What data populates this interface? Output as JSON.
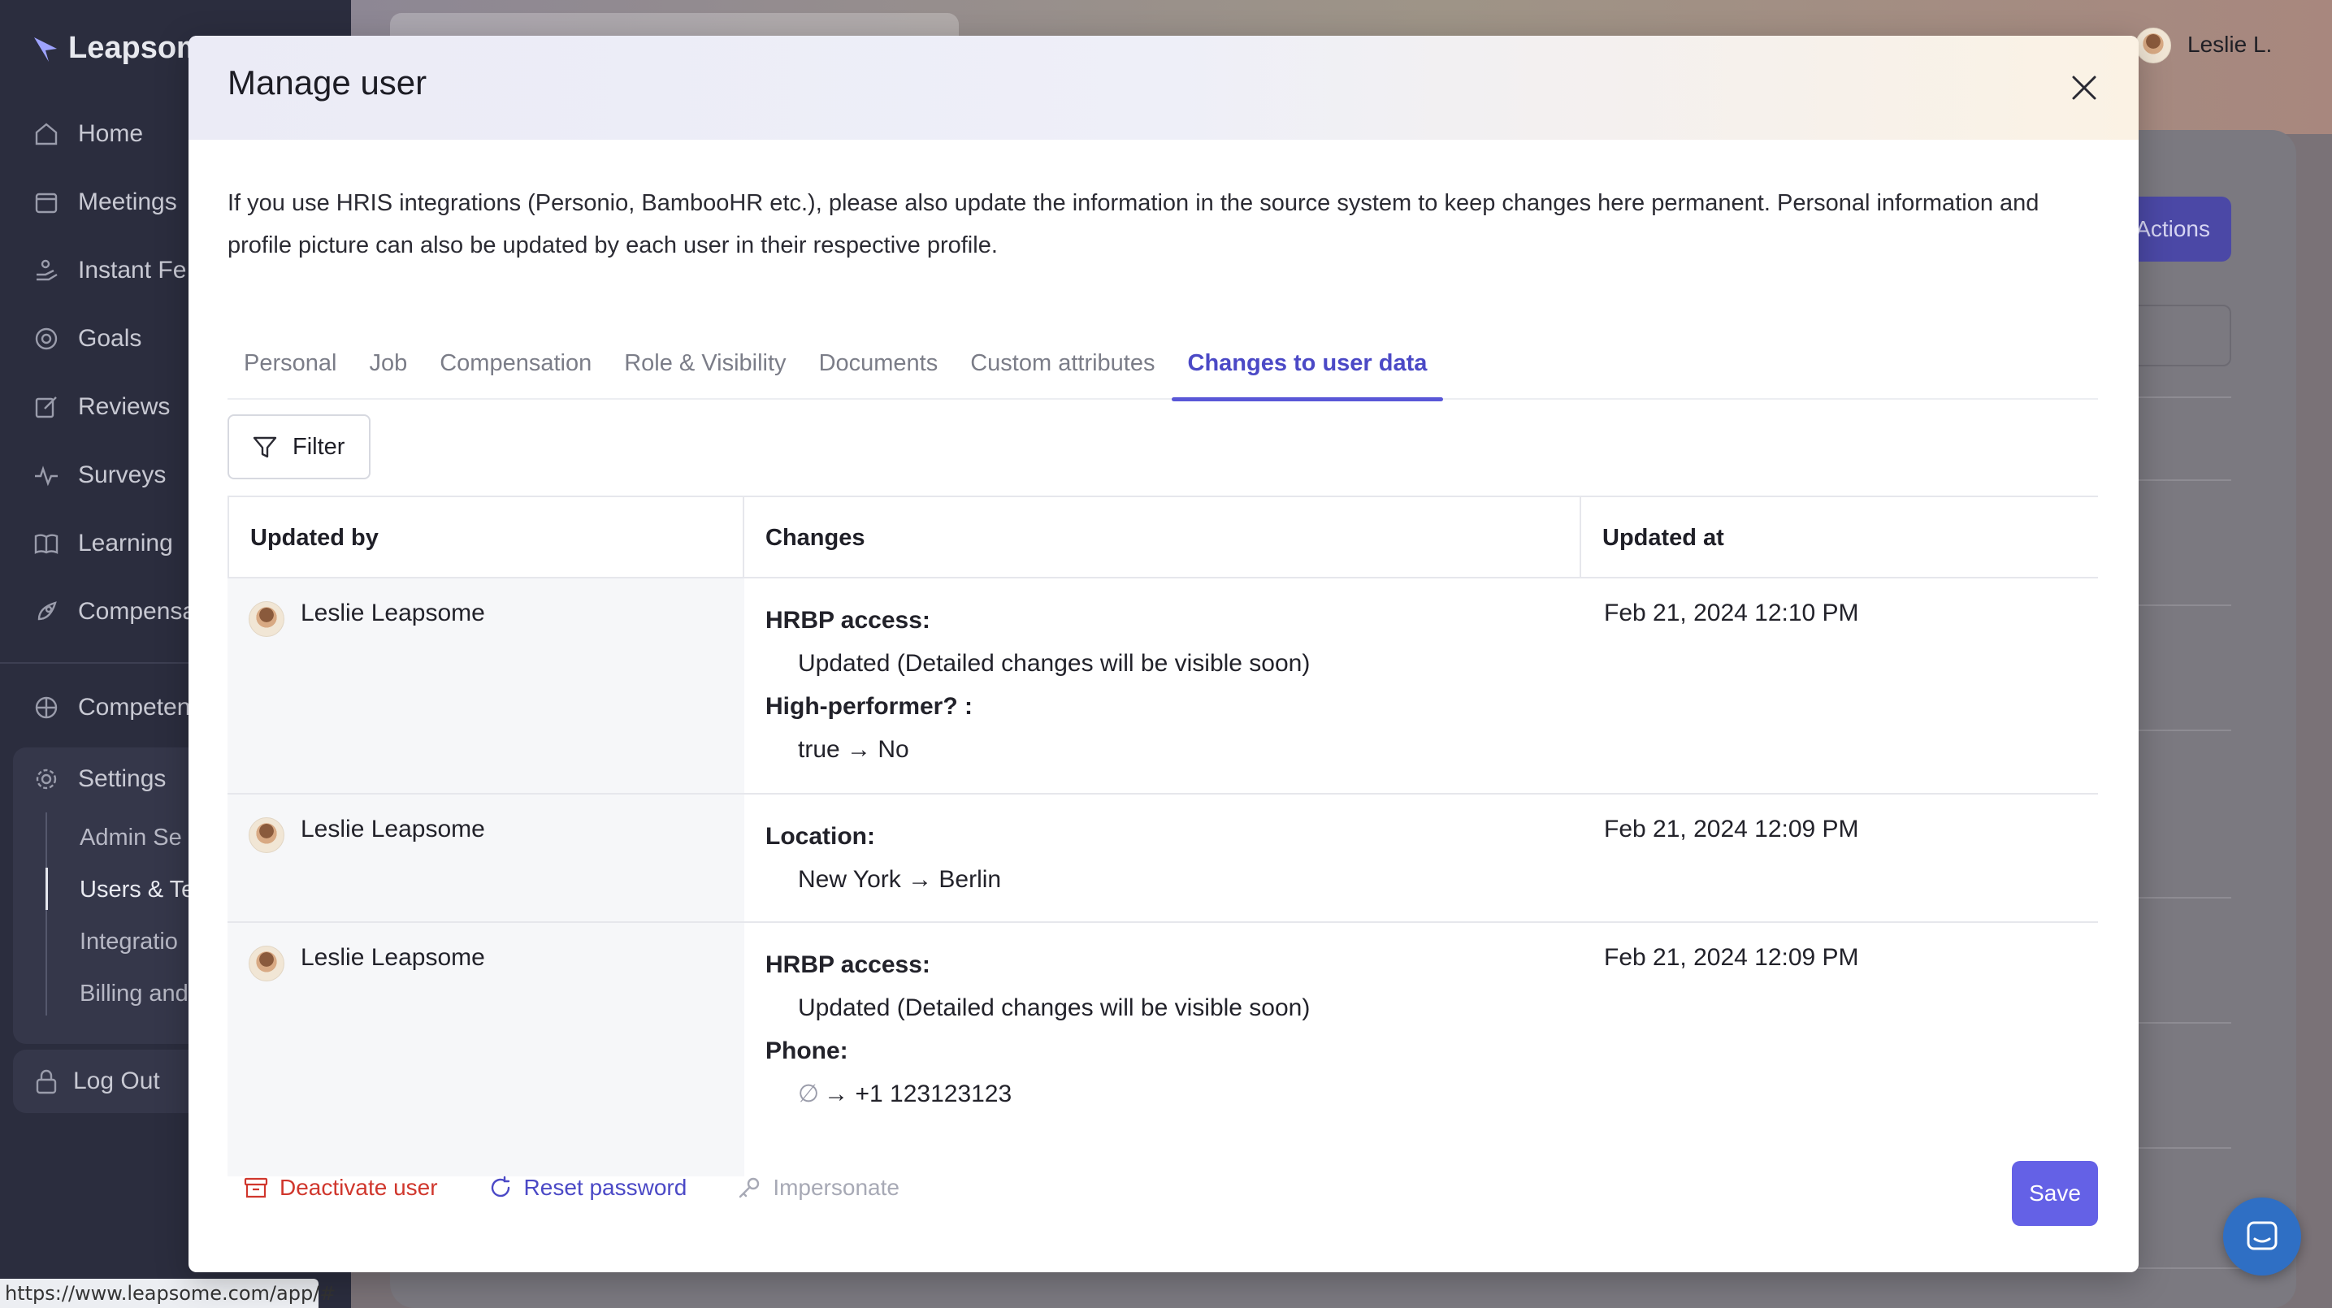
{
  "app": {
    "brand": "Leapsome",
    "status_url": "https://www.leapsome.com/app/#",
    "user_short": "Leslie L.",
    "actions_label": "Actions"
  },
  "sidebar": {
    "items": [
      {
        "label": "Home",
        "icon": "home-icon"
      },
      {
        "label": "Meetings",
        "icon": "calendar-icon"
      },
      {
        "label": "Instant Fe",
        "icon": "hand-icon"
      },
      {
        "label": "Goals",
        "icon": "target-icon"
      },
      {
        "label": "Reviews",
        "icon": "edit-icon"
      },
      {
        "label": "Surveys",
        "icon": "pulse-icon"
      },
      {
        "label": "Learning",
        "icon": "book-icon"
      },
      {
        "label": "Compensa",
        "icon": "rocket-icon"
      }
    ],
    "competencies": "Competen",
    "settings": "Settings",
    "settings_sub": [
      "Admin Se",
      "Users & Te",
      "Integratio",
      "Billing and"
    ],
    "logout": "Log Out"
  },
  "modal": {
    "title": "Manage user",
    "info": "If you use HRIS integrations (Personio, BambooHR etc.), please also update the information in the source system to keep changes here permanent. Personal information and profile picture can also be updated by each user in their respective profile.",
    "tabs": [
      "Personal",
      "Job",
      "Compensation",
      "Role & Visibility",
      "Documents",
      "Custom attributes",
      "Changes to user data"
    ],
    "active_tab": "Changes to user data",
    "filter_label": "Filter",
    "table": {
      "headers": [
        "Updated by",
        "Changes",
        "Updated at"
      ],
      "rows": [
        {
          "updated_by": "Leslie Leapsome",
          "changes": [
            {
              "label": "HRBP access:",
              "value": "Updated (Detailed changes will be visible soon)"
            },
            {
              "label": "High-performer? :",
              "value": "true → No"
            }
          ],
          "updated_at": "Feb 21, 2024 12:10 PM"
        },
        {
          "updated_by": "Leslie Leapsome",
          "changes": [
            {
              "label": "Location:",
              "value": "New York → Berlin"
            }
          ],
          "updated_at": "Feb 21, 2024 12:09 PM"
        },
        {
          "updated_by": "Leslie Leapsome",
          "changes": [
            {
              "label": "HRBP access:",
              "value": "Updated (Detailed changes will be visible soon)"
            },
            {
              "label": "Phone:",
              "value": "→ +1 123123123",
              "empty_symbol": "∅"
            }
          ],
          "updated_at": "Feb 21, 2024 12:09 PM"
        }
      ]
    },
    "footer": {
      "deactivate": "Deactivate user",
      "reset": "Reset password",
      "impersonate": "Impersonate",
      "save": "Save"
    }
  },
  "colors": {
    "accent": "#5957d7",
    "danger": "#d0372d",
    "sidebar_bg": "#2b2d3e"
  }
}
